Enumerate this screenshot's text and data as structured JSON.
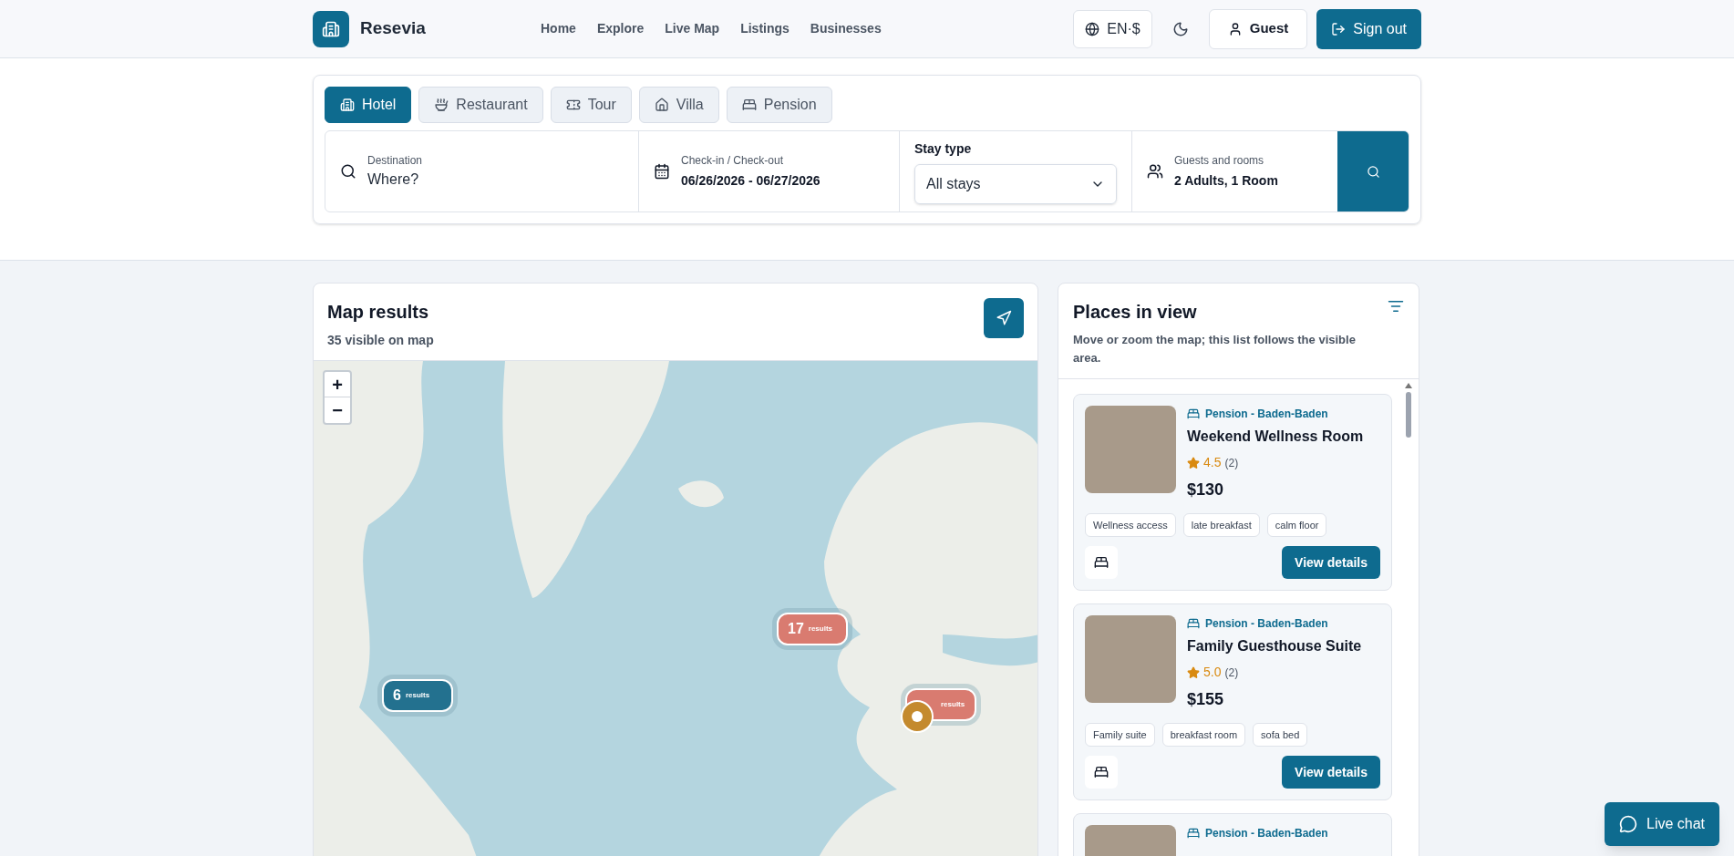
{
  "header": {
    "brand": "Resevia",
    "nav": [
      {
        "label": "Home"
      },
      {
        "label": "Explore"
      },
      {
        "label": "Live Map"
      },
      {
        "label": "Listings"
      },
      {
        "label": "Businesses"
      }
    ],
    "locale": "EN·$",
    "guest": "Guest",
    "sign_out": "Sign out"
  },
  "search": {
    "tabs": [
      {
        "label": "Hotel",
        "selected": true
      },
      {
        "label": "Restaurant",
        "selected": false
      },
      {
        "label": "Tour",
        "selected": false
      },
      {
        "label": "Villa",
        "selected": false
      },
      {
        "label": "Pension",
        "selected": false
      }
    ],
    "destination": {
      "label": "Destination",
      "placeholder": "Where?"
    },
    "dates": {
      "label": "Check-in / Check-out",
      "value": "06/26/2026 - 06/27/2026"
    },
    "stay_type": {
      "label": "Stay type",
      "value": "All stays"
    },
    "guests": {
      "label": "Guests and rooms",
      "value": "2 Adults, 1 Room"
    }
  },
  "map": {
    "title": "Map results",
    "subtitle": "35 visible on map",
    "zoom_in": "+",
    "zoom_out": "−",
    "clusters": [
      {
        "count": "17",
        "label": "results",
        "color": "#d97b70"
      },
      {
        "count": "6",
        "label": "results",
        "color": "#23718f"
      },
      {
        "label": "results",
        "color": "#d97b70"
      }
    ]
  },
  "places": {
    "title": "Places in view",
    "description": "Move or zoom the map; this list follows the visible area.",
    "items": [
      {
        "category": "Pension - Baden-Baden",
        "title": "Weekend Wellness Room",
        "rating": "4.5",
        "reviews": "(2)",
        "price": "$130",
        "tags": [
          "Wellness access",
          "late breakfast",
          "calm floor"
        ],
        "button": "View details"
      },
      {
        "category": "Pension - Baden-Baden",
        "title": "Family Guesthouse Suite",
        "rating": "5.0",
        "reviews": "(2)",
        "price": "$155",
        "tags": [
          "Family suite",
          "breakfast room",
          "sofa bed"
        ],
        "button": "View details"
      },
      {
        "category": "Pension - Baden-Baden"
      }
    ]
  },
  "live_chat": "Live chat"
}
